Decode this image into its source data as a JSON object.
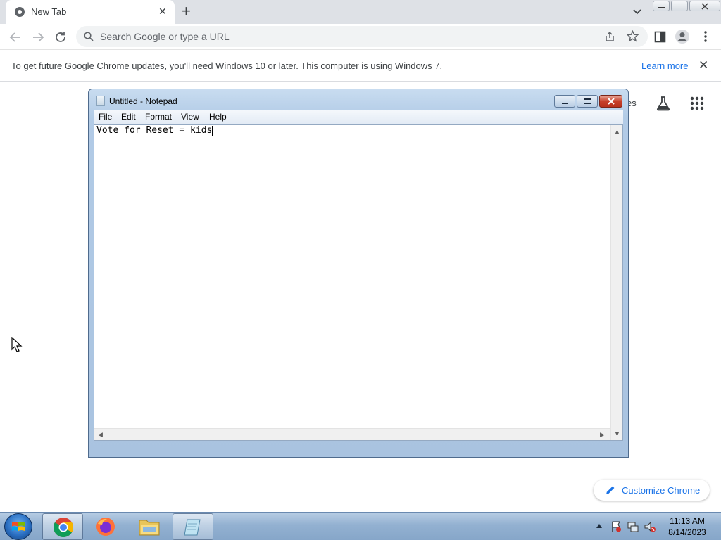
{
  "browser": {
    "tab": {
      "title": "New Tab",
      "close_glyph": "✕"
    },
    "new_tab_glyph": "+",
    "omnibox": {
      "placeholder": "Search Google or type a URL"
    },
    "infobar": {
      "message": "To get future Google Chrome updates, you'll need Windows 10 or later. This computer is using Windows 7.",
      "link": "Learn more",
      "close_glyph": "✕"
    },
    "ntp": {
      "images_link_partial": "es",
      "customize_label": "Customize Chrome"
    }
  },
  "notepad": {
    "title": "Untitled - Notepad",
    "menus": [
      "File",
      "Edit",
      "Format",
      "View",
      "Help"
    ],
    "content": "Vote for Reset = kids"
  },
  "taskbar": {
    "clock_time": "11:13 AM",
    "clock_date": "8/14/2023"
  },
  "colors": {
    "accent_blue": "#1a73e8",
    "tabstrip_bg": "#dee1e6",
    "taskbar_bg": "#93b1d1"
  },
  "icons": {
    "tab": "chrome-favicon-icon",
    "nav": [
      "back-icon",
      "forward-icon",
      "reload-icon"
    ],
    "omnibox": [
      "search-icon",
      "share-icon",
      "bookmark-star-icon"
    ],
    "toolbar_right": [
      "side-panel-icon",
      "profile-icon",
      "menu-dots-icon"
    ],
    "ntp": [
      "labs-flask-icon",
      "apps-grid-icon",
      "pencil-icon"
    ],
    "taskbar": [
      "start-orb-icon",
      "chrome-icon",
      "firefox-icon",
      "file-explorer-icon",
      "notepad-icon"
    ],
    "tray": [
      "show-hidden-icons-arrow",
      "action-center-flag-icon",
      "network-icon",
      "volume-muted-icon"
    ]
  }
}
